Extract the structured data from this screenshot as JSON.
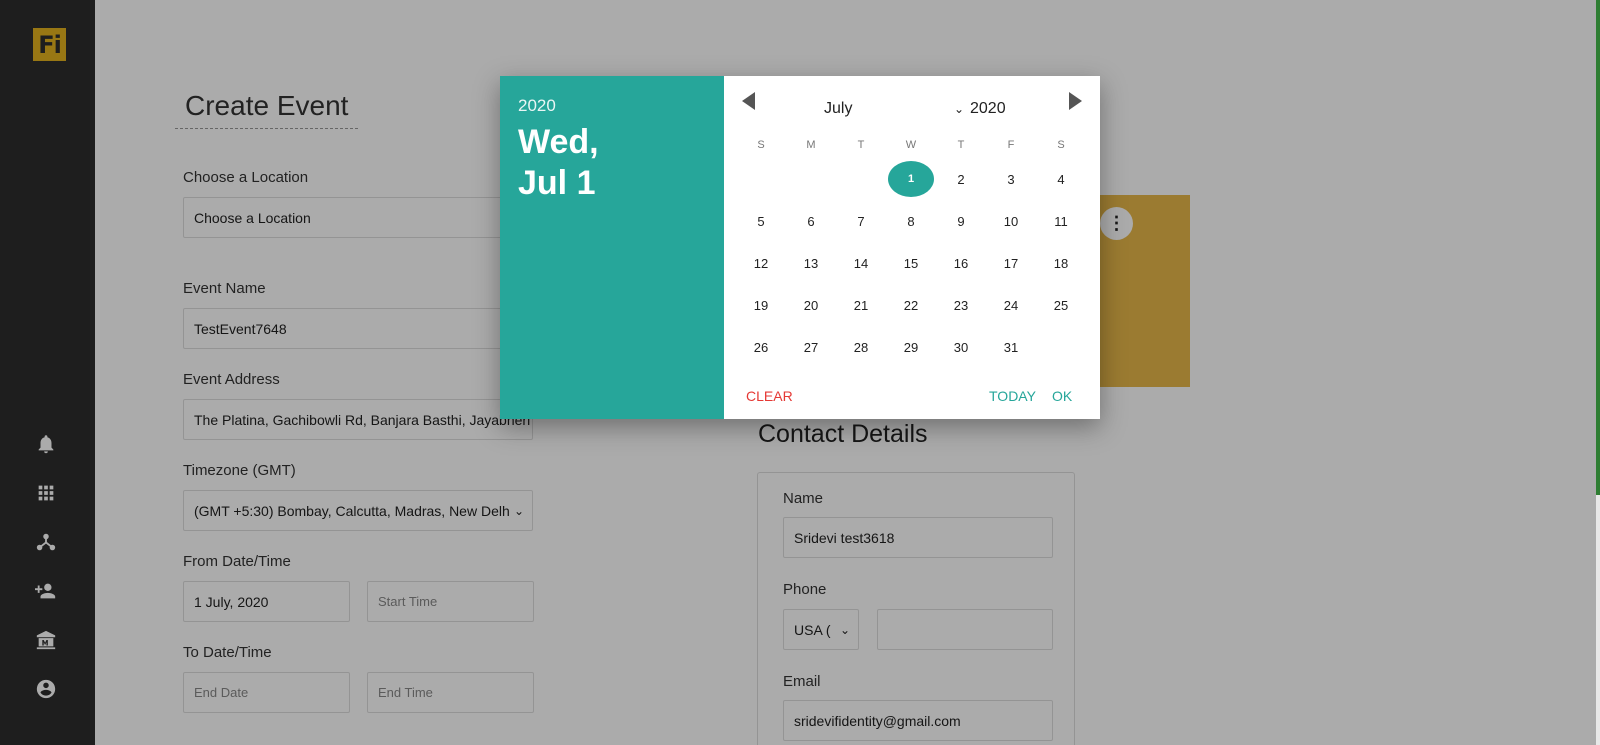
{
  "app": {
    "logo_text": "Fi"
  },
  "sidebar": {
    "icons": [
      "bell-icon",
      "apps-grid-icon",
      "network-icon",
      "add-user-icon",
      "museum-icon",
      "account-circle-icon"
    ]
  },
  "page": {
    "title": "Create Event",
    "location": {
      "label": "Choose a Location",
      "value": "Choose a Location"
    },
    "event_name": {
      "label": "Event Name",
      "value": "TestEvent7648"
    },
    "event_address": {
      "label": "Event Address",
      "value": "The Platina, Gachibowli Rd, Banjara Basthi, Jayabheri E"
    },
    "timezone": {
      "label": "Timezone (GMT)",
      "value": "(GMT +5:30) Bombay, Calcutta, Madras, New Delh"
    },
    "from": {
      "label": "From Date/Time",
      "date_value": "1 July, 2020",
      "time_placeholder": "Start Time"
    },
    "to": {
      "label": "To Date/Time",
      "date_placeholder": "End Date",
      "time_placeholder": "End Time"
    }
  },
  "contact": {
    "title": "Contact Details",
    "name": {
      "label": "Name",
      "value": "Sridevi test3618"
    },
    "phone": {
      "label": "Phone",
      "country": "USA (",
      "value": ""
    },
    "email": {
      "label": "Email",
      "value": "sridevifidentity@gmail.com"
    }
  },
  "picker": {
    "year": "2020",
    "day_line": "Wed,",
    "date_line": "Jul 1",
    "month": "July",
    "year_select": "2020",
    "weekdays": [
      "S",
      "M",
      "T",
      "W",
      "T",
      "F",
      "S"
    ],
    "days": [
      "1",
      "2",
      "3",
      "4",
      "5",
      "6",
      "7",
      "8",
      "9",
      "10",
      "11",
      "12",
      "13",
      "14",
      "15",
      "16",
      "17",
      "18",
      "19",
      "20",
      "21",
      "22",
      "23",
      "24",
      "25",
      "26",
      "27",
      "28",
      "29",
      "30",
      "31"
    ],
    "selected_day": "1",
    "clear_label": "CLEAR",
    "today_label": "TODAY",
    "ok_label": "OK"
  },
  "colors": {
    "accent": "#26a69a",
    "clear": "#e53935",
    "sidebar": "#2d2d2d",
    "logo": "#e3b21f"
  }
}
